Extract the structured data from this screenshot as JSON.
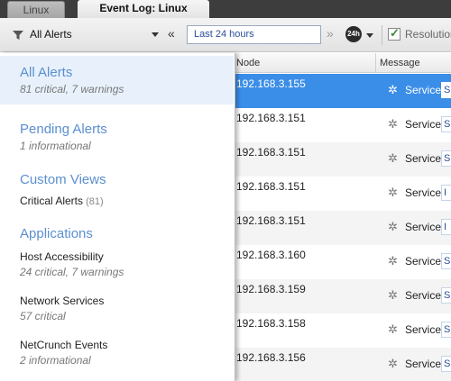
{
  "tabs": [
    {
      "label": "Linux"
    },
    {
      "label": "Event Log: Linux"
    }
  ],
  "toolbar": {
    "alert_filter": "All Alerts",
    "prev": "«",
    "time_range": "Last 24 hours",
    "next": "»",
    "clock_badge": "24h",
    "resolution_label": "Resolution",
    "resolution_checked": true
  },
  "columns": {
    "node": "Node",
    "message": "Message"
  },
  "rows": [
    {
      "ip": "192.168.3.155",
      "msg": "Service",
      "badge": "S"
    },
    {
      "ip": "192.168.3.151",
      "msg": "Service",
      "badge": "S"
    },
    {
      "ip": "192.168.3.151",
      "msg": "Service",
      "badge": "S"
    },
    {
      "ip": "192.168.3.151",
      "msg": "Service",
      "badge": "I"
    },
    {
      "ip": "192.168.3.151",
      "msg": "Service",
      "badge": "I"
    },
    {
      "ip": "192.168.3.160",
      "msg": "Service",
      "badge": "S"
    },
    {
      "ip": "192.168.3.159",
      "msg": "Service",
      "badge": "S"
    },
    {
      "ip": "192.168.3.158",
      "msg": "Service",
      "badge": "S"
    },
    {
      "ip": "192.168.3.156",
      "msg": "Service",
      "badge": "S"
    }
  ],
  "panel": {
    "all_alerts": {
      "title": "All Alerts",
      "sub": "81 critical, 7 warnings"
    },
    "pending": {
      "title": "Pending Alerts",
      "sub": "1 informational"
    },
    "custom_views": {
      "title": "Custom Views",
      "items": [
        {
          "name": "Critical Alerts",
          "count": "(81)"
        }
      ]
    },
    "applications": {
      "title": "Applications",
      "items": [
        {
          "name": "Host Accessibility",
          "sub": "24 critical, 7 warnings"
        },
        {
          "name": "Network Services",
          "sub": "57 critical"
        },
        {
          "name": "NetCrunch Events",
          "sub": "2 informational"
        }
      ]
    }
  },
  "icons": {
    "filter": "funnel-icon",
    "gear": "gear-icon",
    "clock": "clock-24h-icon",
    "checkbox": "checkbox-icon"
  }
}
